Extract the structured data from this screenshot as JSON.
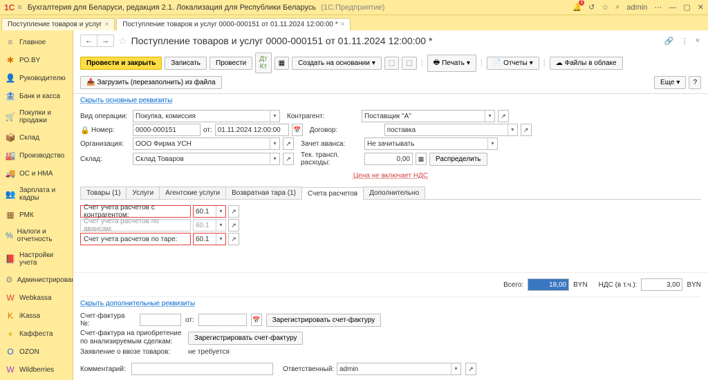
{
  "titlebar": {
    "app": "Бухгалтерия для Беларуси, редакция 2.1. Локализация для Республики Беларусь",
    "suffix": "(1С:Предприятие)",
    "user": "admin"
  },
  "tabs": [
    {
      "label": "Поступление товаров и услуг"
    },
    {
      "label": "Поступление товаров и услуг 0000-000151 от 01.11.2024 12:00:00 *"
    }
  ],
  "sidebar": [
    {
      "icon": "≡",
      "label": "Главное",
      "color": "#888"
    },
    {
      "icon": "✱",
      "label": "РО.BY",
      "color": "#e07000"
    },
    {
      "icon": "👤",
      "label": "Руководителю",
      "color": "#888"
    },
    {
      "icon": "🏦",
      "label": "Банк и касса",
      "color": "#c09040"
    },
    {
      "icon": "🛒",
      "label": "Покупки и продажи",
      "color": "#555"
    },
    {
      "icon": "📦",
      "label": "Склад",
      "color": "#8a5030"
    },
    {
      "icon": "🏭",
      "label": "Производство",
      "color": "#666"
    },
    {
      "icon": "🚚",
      "label": "ОС и НМА",
      "color": "#666"
    },
    {
      "icon": "👥",
      "label": "Зарплата и кадры",
      "color": "#888"
    },
    {
      "icon": "▦",
      "label": "РМК",
      "color": "#8a5030"
    },
    {
      "icon": "%",
      "label": "Налоги и отчетность",
      "color": "#4080c0"
    },
    {
      "icon": "📕",
      "label": "Настройки учета",
      "color": "#8a5030"
    },
    {
      "icon": "⚙",
      "label": "Администрирование",
      "color": "#888"
    },
    {
      "icon": "W",
      "label": "Webkassa",
      "color": "#e04040"
    },
    {
      "icon": "K",
      "label": "iKassa",
      "color": "#e07000"
    },
    {
      "icon": "●",
      "label": "Каффеста",
      "color": "#f0c040"
    },
    {
      "icon": "O",
      "label": "OZON",
      "color": "#3060e0"
    },
    {
      "icon": "W",
      "label": "Wildberries",
      "color": "#a040c0"
    }
  ],
  "doc": {
    "title": "Поступление товаров и услуг 0000-000151 от 01.11.2024 12:00:00 *"
  },
  "toolbar": {
    "post_close": "Провести и закрыть",
    "write": "Записать",
    "post": "Провести",
    "create_based": "Создать на основании",
    "print": "Печать",
    "reports": "Отчеты",
    "cloud": "Файлы в облаке",
    "load": "Загрузить (перезаполнить) из файла",
    "more": "Еще"
  },
  "links": {
    "hide_main": "Скрыть основные реквизиты",
    "hide_extra": "Скрыть дополнительные реквизиты",
    "price_no_vat": "Цена не включает НДС"
  },
  "fields": {
    "op_type": {
      "label": "Вид операции:",
      "value": "Покупка, комиссия"
    },
    "number": {
      "label": "Номер:",
      "value": "0000-000151",
      "from": "от:",
      "date": "01.11.2024 12:00:00"
    },
    "org": {
      "label": "Организация:",
      "value": "ООО Фирма УСН"
    },
    "warehouse": {
      "label": "Склад:",
      "value": "Склад Товаров"
    },
    "contractor": {
      "label": "Контрагент:",
      "value": "Поставщик \"А\""
    },
    "contract": {
      "label": "Договор:",
      "value": "поставка"
    },
    "advance": {
      "label": "Зачет аванса:",
      "value": "Не зачитывать"
    },
    "transport": {
      "label": "Тек. трансп. расходы:",
      "value": "0,00"
    },
    "distribute": "Распределить"
  },
  "tabs2": [
    "Товары (1)",
    "Услуги",
    "Агентские услуги",
    "Возвратная тара (1)",
    "Счета расчетов",
    "Дополнительно"
  ],
  "accounts": {
    "contractor": {
      "label": "Счет учета расчетов с контрагентом:",
      "value": "60.1"
    },
    "advance": {
      "label": "Счет учета расчетов по авансам:",
      "value": "60.1"
    },
    "tare": {
      "label": "Счет учета расчетов по таре:",
      "value": "60.1"
    }
  },
  "totals": {
    "total_lbl": "Всего:",
    "total": "18,00",
    "cur": "BYN",
    "vat_lbl": "НДС (в т.ч.):",
    "vat": "3,00"
  },
  "footer": {
    "invoice_no": "Счет-фактура №:",
    "from": "от:",
    "reg_invoice": "Зарегистрировать счет-фактуру",
    "sf_purchase": "Счет-фактура на приобретение по анализируемым сделкам:",
    "reg_sf": "Зарегистрировать счет-фактуру",
    "import_decl": "Заявление о ввозе товаров:",
    "import_val": "не требуется",
    "comment": "Комментарий:",
    "responsible": "Ответственный:",
    "resp_val": "admin"
  }
}
